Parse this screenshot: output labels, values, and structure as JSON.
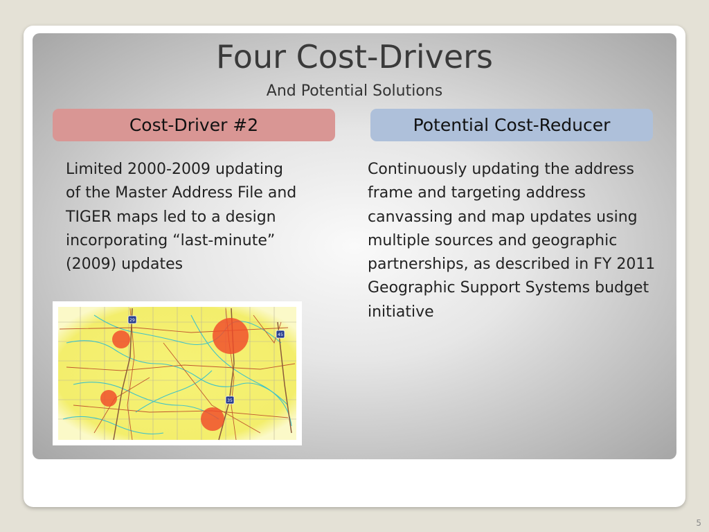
{
  "slide": {
    "title": "Four Cost-Drivers",
    "subtitle": "And Potential Solutions",
    "page_number": "5"
  },
  "left_column": {
    "header": "Cost-Driver #2",
    "header_color": "#d99694",
    "body": "Limited 2000-2009 updating of the Master Address File and TIGER maps led to a design incorporating “last-minute” (2009) updates"
  },
  "right_column": {
    "header": "Potential Cost-Reducer",
    "header_color": "#aec0da",
    "body": "Continuously updating the address frame and targeting address canvassing and map updates using multiple sources and geographic partnerships, as described in FY 2011 Geographic Support Systems budget initiative"
  },
  "map": {
    "interstate_shields": [
      "29",
      "45",
      "35"
    ],
    "highlight_color": "#f04a2a",
    "land_color": "#f4f070"
  }
}
